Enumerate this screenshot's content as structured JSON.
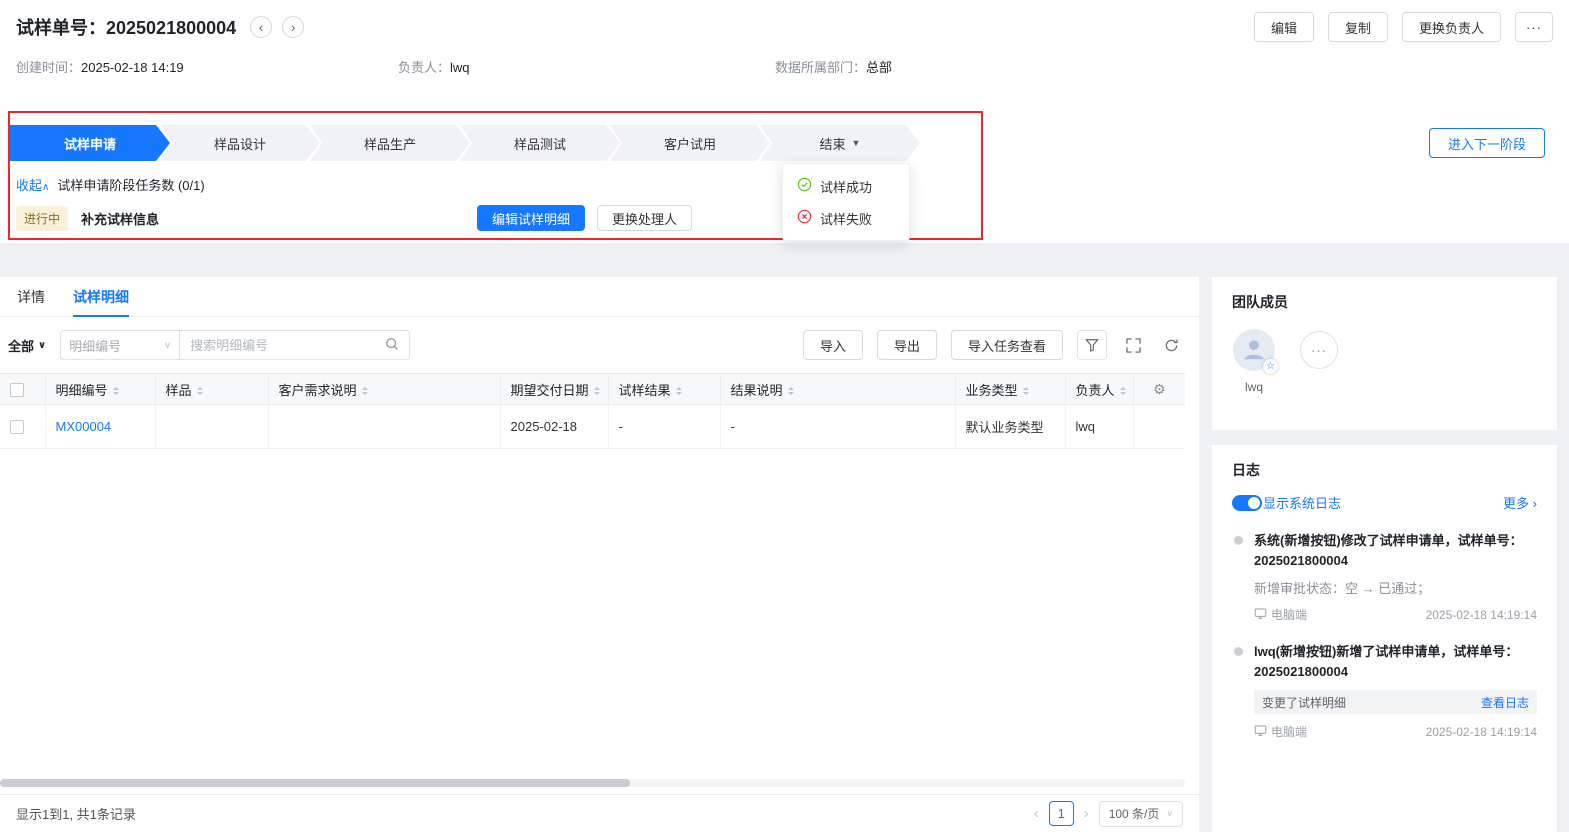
{
  "icons": {
    "prev": "‹",
    "next": "›",
    "more": "···",
    "caret_down": "▼",
    "chevron_down": "∨",
    "collapse_caret": "∧",
    "gear": "⚙",
    "star": "☆",
    "arrow_right": "›"
  },
  "header": {
    "title_label": "试样单号：",
    "title_value": "2025021800004",
    "edit_button": "编辑",
    "copy_button": "复制",
    "change_owner_button": "更换负责人",
    "created_label": "创建时间：",
    "created_value": "2025-02-18 14:19",
    "owner_label": "负责人：",
    "owner_value": "lwq",
    "dept_label": "数据所属部门：",
    "dept_value": "总部"
  },
  "stages": {
    "items": [
      {
        "label": "试样申请"
      },
      {
        "label": "样品设计"
      },
      {
        "label": "样品生产"
      },
      {
        "label": "样品测试"
      },
      {
        "label": "客户试用"
      },
      {
        "label": "结束"
      }
    ],
    "menu": {
      "success_label": "试样成功",
      "fail_label": "试样失败"
    },
    "next_stage_button": "进入下一阶段",
    "collapse_link": "收起",
    "task_count_text": "试样申请阶段任务数 (0/1)",
    "status_badge": "进行中",
    "task_name": "补充试样信息",
    "edit_detail_button": "编辑试样明细",
    "change_handler_button": "更换处理人"
  },
  "tabs": {
    "detail": "详情",
    "sample_detail": "试样明细"
  },
  "toolbar": {
    "filter_all": "全部",
    "field_select_placeholder": "明细编号",
    "search_placeholder": "搜索明细编号",
    "import_button": "导入",
    "export_button": "导出",
    "import_task_button": "导入任务查看"
  },
  "table": {
    "headers": [
      "明细编号",
      "样品",
      "客户需求说明",
      "期望交付日期",
      "试样结果",
      "结果说明",
      "业务类型",
      "负责人"
    ],
    "row": {
      "code": "MX00004",
      "sample": "",
      "requirement": "",
      "delivery_date": "2025-02-18",
      "result": "-",
      "result_desc": "-",
      "biz_type": "默认业务类型",
      "owner": "lwq"
    }
  },
  "footer": {
    "summary": "显示1到1, 共1条记录",
    "page": "1",
    "page_size": "100 条/页"
  },
  "team": {
    "title": "团队成员",
    "member_name": "lwq"
  },
  "logs": {
    "title": "日志",
    "toggle_label": "显示系统日志",
    "more_link": "更多",
    "entries": [
      {
        "title": "系统(新增按钮)修改了试样申请单，试样单号：2025021800004",
        "detail": "新增审批状态：空 → 已通过；",
        "device": "电脑端",
        "time": "2025-02-18 14:19:14"
      },
      {
        "title": "lwq(新增按钮)新增了试样申请单，试样单号：2025021800004",
        "change_text": "变更了试样明细",
        "view_link": "查看日志",
        "device": "电脑端",
        "time": "2025-02-18 14:19:14"
      }
    ]
  }
}
